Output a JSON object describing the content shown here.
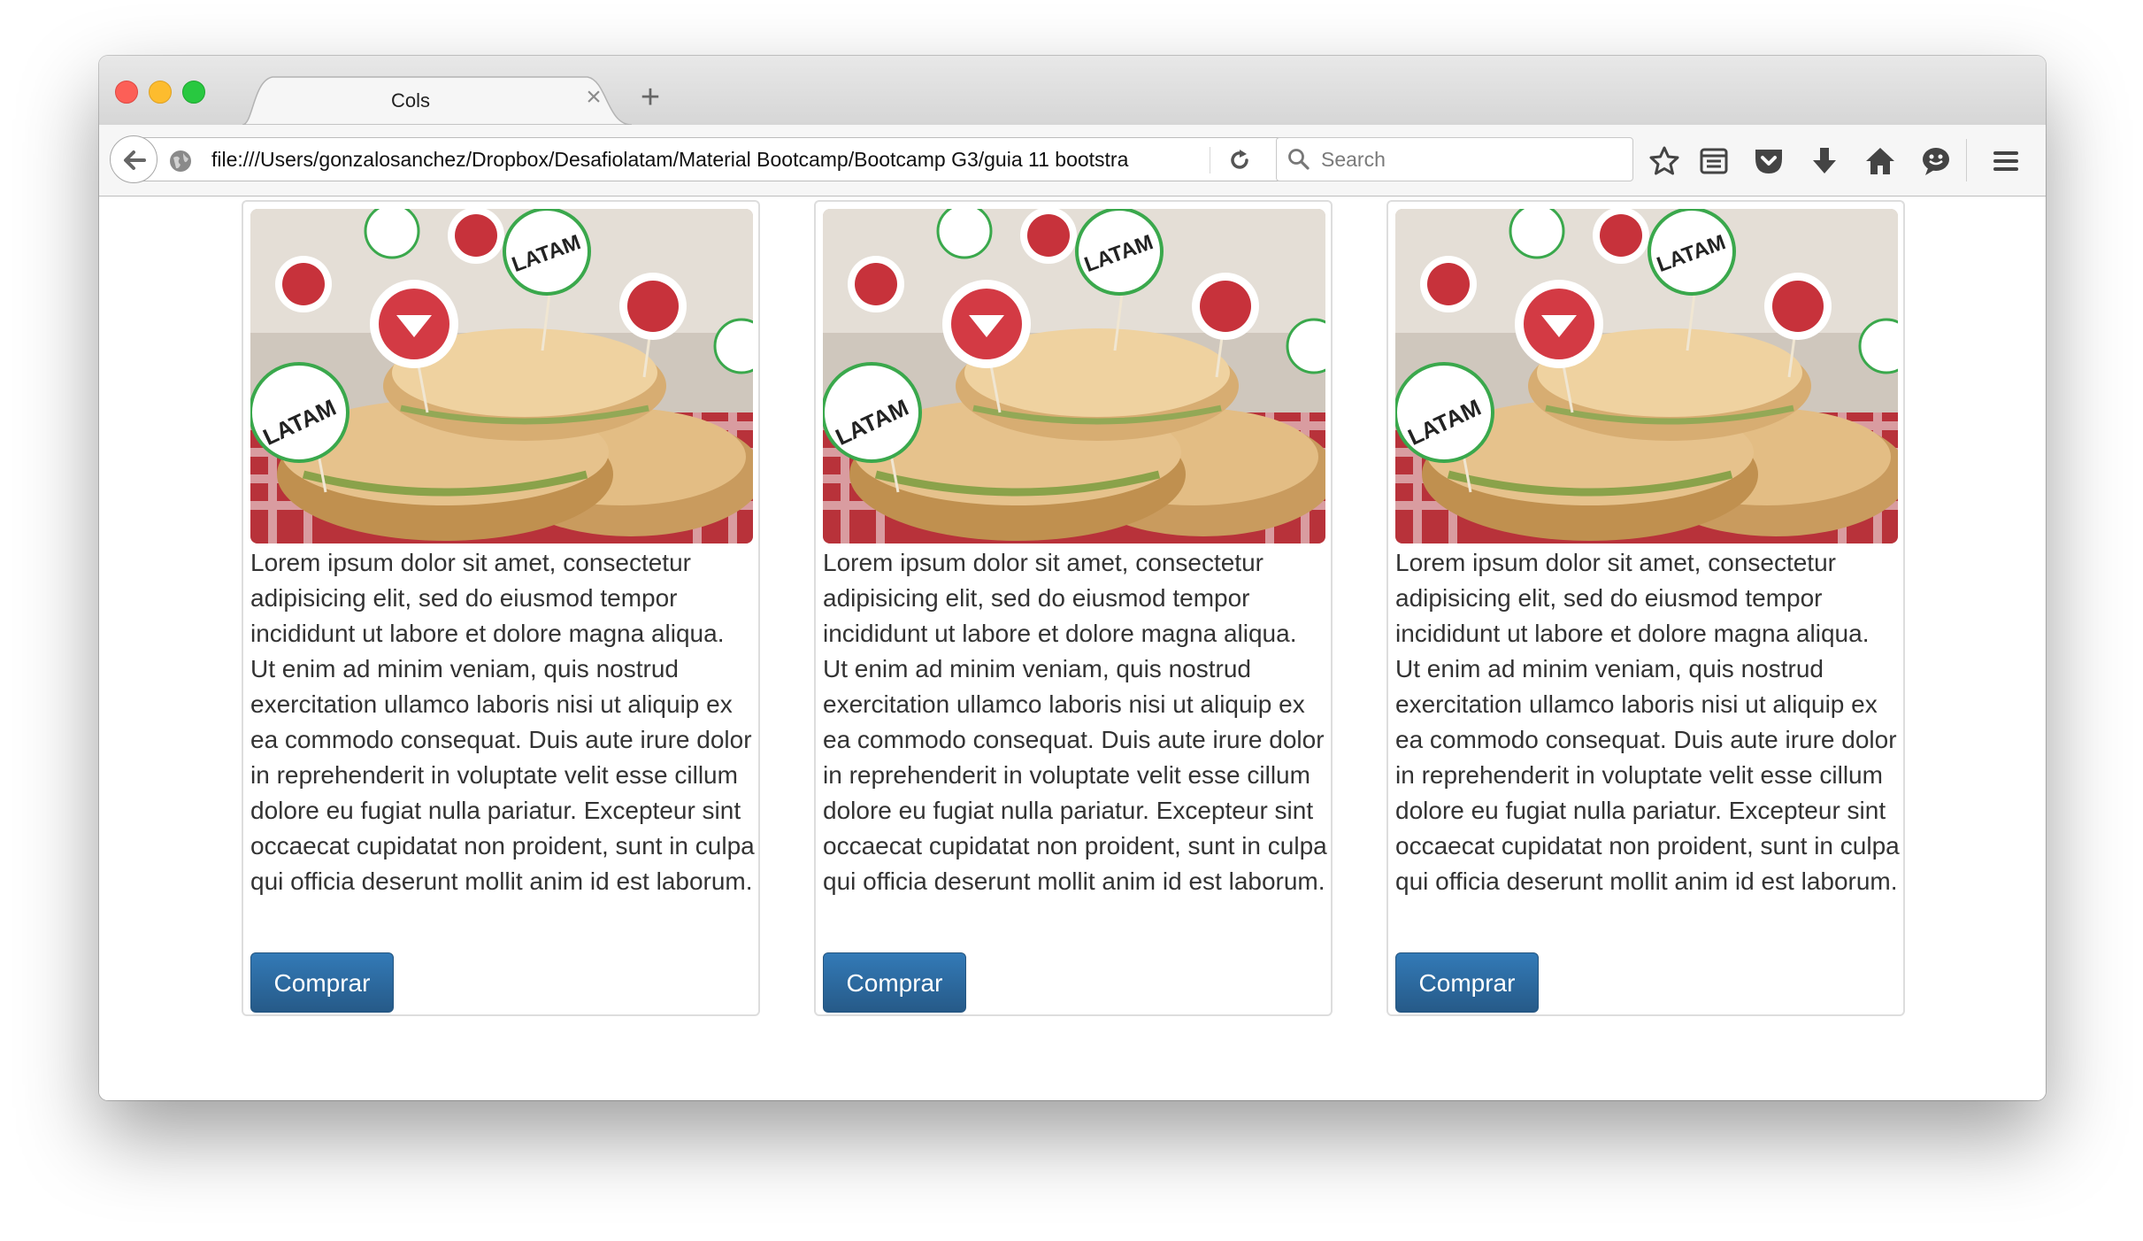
{
  "browser": {
    "tab": {
      "title": "Cols",
      "close_glyph": "×"
    },
    "new_tab_glyph": "+",
    "url": "file:///Users/gonzalosanchez/Dropbox/Desafiolatam/Material Bootcamp/Bootcamp G3/guia 11 bootstra",
    "search_placeholder": "Search",
    "icons": [
      "back-arrow-icon",
      "globe-icon",
      "reload-icon",
      "search-icon",
      "bookmark-star-icon",
      "reading-list-icon",
      "pocket-icon",
      "download-icon",
      "home-icon",
      "chat-icon",
      "hamburger-menu-icon"
    ]
  },
  "cards": [
    {
      "image": "sandwich-photo-desafio-latam",
      "text": "Lorem ipsum dolor sit amet, consectetur adipisicing elit, sed do eiusmod tempor incididunt ut labore et dolore magna aliqua. Ut enim ad minim veniam, quis nostrud exercitation ullamco laboris nisi ut aliquip ex ea commodo consequat. Duis aute irure dolor in reprehenderit in voluptate velit esse cillum dolore eu fugiat nulla pariatur. Excepteur sint occaecat cupidatat non proident, sunt in culpa qui officia deserunt mollit anim id est laborum.",
      "button": "Comprar"
    },
    {
      "image": "sandwich-photo-desafio-latam",
      "text": "Lorem ipsum dolor sit amet, consectetur adipisicing elit, sed do eiusmod tempor incididunt ut labore et dolore magna aliqua. Ut enim ad minim veniam, quis nostrud exercitation ullamco laboris nisi ut aliquip ex ea commodo consequat. Duis aute irure dolor in reprehenderit in voluptate velit esse cillum dolore eu fugiat nulla pariatur. Excepteur sint occaecat cupidatat non proident, sunt in culpa qui officia deserunt mollit anim id est laborum.",
      "button": "Comprar"
    },
    {
      "image": "sandwich-photo-desafio-latam",
      "text": "Lorem ipsum dolor sit amet, consectetur adipisicing elit, sed do eiusmod tempor incididunt ut labore et dolore magna aliqua. Ut enim ad minim veniam, quis nostrud exercitation ullamco laboris nisi ut aliquip ex ea commodo consequat. Duis aute irure dolor in reprehenderit in voluptate velit esse cillum dolore eu fugiat nulla pariatur. Excepteur sint occaecat cupidatat non proident, sunt in culpa qui officia deserunt mollit anim id est laborum.",
      "button": "Comprar"
    }
  ],
  "colors": {
    "primary_button": "#337ab7",
    "primary_button_dark": "#265a88",
    "text": "#333333"
  }
}
